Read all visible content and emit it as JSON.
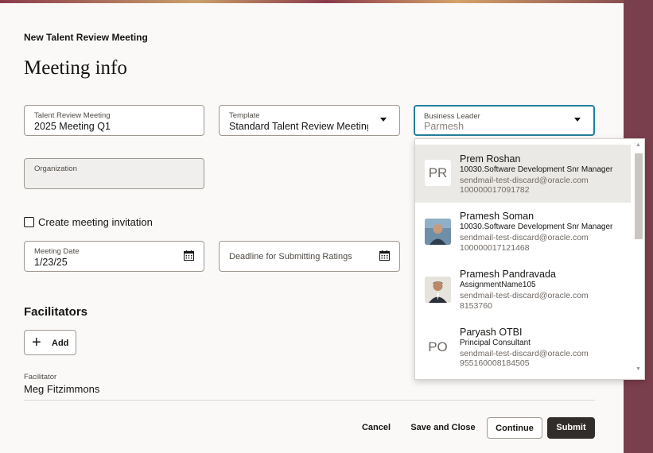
{
  "header": {
    "title": "New Talent Review Meeting"
  },
  "page": {
    "title": "Meeting info"
  },
  "fields": {
    "talent_review_meeting": {
      "label": "Talent Review Meeting",
      "value": "2025 Meeting Q1"
    },
    "template": {
      "label": "Template",
      "value": "Standard Talent Review Meeting"
    },
    "business_leader": {
      "label": "Business Leader",
      "value": "Parmesh"
    },
    "organization": {
      "label": "Organization",
      "value": ""
    },
    "meeting_date": {
      "label": "Meeting Date",
      "value": "1/23/25"
    },
    "deadline": {
      "label": "Deadline for Submitting Ratings",
      "value": ""
    }
  },
  "invitation": {
    "label": "Create meeting invitation",
    "checked": false
  },
  "facilitators": {
    "section_title": "Facilitators",
    "add_label": "Add",
    "facilitator_label": "Facilitator",
    "facilitator_value": "Meg Fitzimmons"
  },
  "footer": {
    "cancel": "Cancel",
    "save_close": "Save and Close",
    "continue": "Continue",
    "submit": "Submit"
  },
  "dropdown": {
    "options": [
      {
        "initials": "PR",
        "name": "Prem Roshan",
        "role": "10030.Software Development Snr Manager",
        "email": "sendmail-test-discard@oracle.com",
        "id": "100000017091782",
        "selected": true,
        "avatar": "initials"
      },
      {
        "initials": "",
        "name": "Pramesh Soman",
        "role": "10030.Software Development Snr Manager",
        "email": "sendmail-test-discard@oracle.com",
        "id": "100000017121468",
        "selected": false,
        "avatar": "photo"
      },
      {
        "initials": "",
        "name": "Pramesh Pandravada",
        "role": "AssignmentName105",
        "email": "sendmail-test-discard@oracle.com",
        "id": "8153760",
        "selected": false,
        "avatar": "photo"
      },
      {
        "initials": "PO",
        "name": "Paryash OTBI",
        "role": "Principal Consultant",
        "email": "sendmail-test-discard@oracle.com",
        "id": "955160008184505",
        "selected": false,
        "avatar": "initials"
      }
    ]
  },
  "colors": {
    "accent": "#227e9e",
    "primary_button": "#312d2a",
    "brand_stripe": "#7a3f4c"
  }
}
